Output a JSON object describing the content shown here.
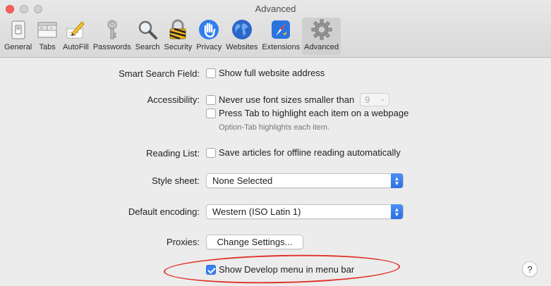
{
  "window": {
    "title": "Advanced"
  },
  "toolbar": {
    "items": [
      {
        "label": "General",
        "icon": "general-switch-icon"
      },
      {
        "label": "Tabs",
        "icon": "tabs-icon"
      },
      {
        "label": "AutoFill",
        "icon": "autofill-pencil-icon"
      },
      {
        "label": "Passwords",
        "icon": "key-icon"
      },
      {
        "label": "Search",
        "icon": "magnifier-icon"
      },
      {
        "label": "Security",
        "icon": "padlock-icon"
      },
      {
        "label": "Privacy",
        "icon": "hand-icon"
      },
      {
        "label": "Websites",
        "icon": "globe-icon"
      },
      {
        "label": "Extensions",
        "icon": "extensions-compass-icon"
      },
      {
        "label": "Advanced",
        "icon": "gear-icon"
      }
    ],
    "selected": "Advanced"
  },
  "settings": {
    "smart_search": {
      "label": "Smart Search Field:",
      "option": "Show full website address",
      "checked": false
    },
    "accessibility": {
      "label": "Accessibility:",
      "option1": "Never use font sizes smaller than",
      "font_size_value": "9",
      "option2": "Press Tab to highlight each item on a webpage",
      "hint": "Option-Tab highlights each item."
    },
    "reading_list": {
      "label": "Reading List:",
      "option": "Save articles for offline reading automatically"
    },
    "style_sheet": {
      "label": "Style sheet:",
      "value": "None Selected"
    },
    "encoding": {
      "label": "Default encoding:",
      "value": "Western (ISO Latin 1)"
    },
    "proxies": {
      "label": "Proxies:",
      "button": "Change Settings..."
    },
    "develop": {
      "option": "Show Develop menu in menu bar",
      "checked": true
    }
  },
  "help": {
    "label": "?"
  },
  "colors": {
    "accent": "#3b82f6",
    "annotation": "#e0342a",
    "close": "#ff5f57",
    "traffic_inactive": "#d0d0d0"
  }
}
